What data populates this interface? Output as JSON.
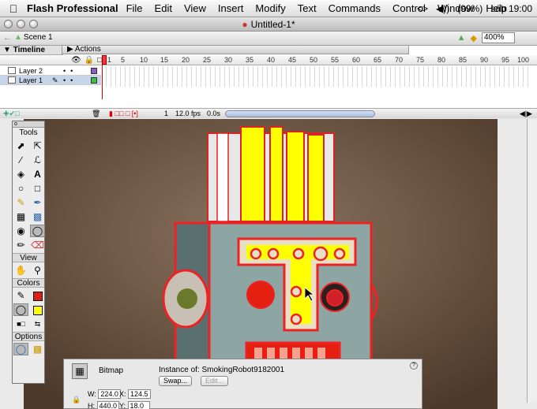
{
  "menubar": {
    "app_name": "Flash Professional",
    "menus": [
      "File",
      "Edit",
      "View",
      "Insert",
      "Modify",
      "Text",
      "Commands",
      "Control",
      "Window",
      "Help"
    ],
    "status": {
      "arrows": "<>",
      "volume": "◀))",
      "battery": "(99%)",
      "clock": "sáb 19:00"
    }
  },
  "window": {
    "title": "Untitled-1*"
  },
  "editbar": {
    "scene_label": "Scene 1",
    "zoom": "400%"
  },
  "actions_panel": {
    "label": "▶ Actions"
  },
  "timeline": {
    "label": "▼ Timeline",
    "ruler_ticks": [
      "1",
      "5",
      "10",
      "15",
      "20",
      "25",
      "30",
      "35",
      "40",
      "45",
      "50",
      "55",
      "60",
      "65",
      "70",
      "75",
      "80",
      "85",
      "90",
      "95",
      "100"
    ],
    "layers": [
      {
        "name": "Layer 2",
        "color": "#8b5cc7",
        "selected": false
      },
      {
        "name": "Layer 1",
        "color": "#3cbf3c",
        "selected": true
      }
    ],
    "current_frame": "1",
    "fps": "12.0 fps",
    "elapsed": "0.0s"
  },
  "tools": {
    "title": "Tools",
    "view_label": "View",
    "colors_label": "Colors",
    "options_label": "Options",
    "stroke_color": "#e02010",
    "fill_color": "#ffff00"
  },
  "properties": {
    "type_label": "Bitmap",
    "instance_label": "Instance of:",
    "instance_name": "SmokingRobot9182001",
    "swap_label": "Swap...",
    "edit_label": "Edit...",
    "w_label": "W:",
    "w_value": "224.0",
    "h_label": "H:",
    "h_value": "440.0",
    "x_label": "X:",
    "x_value": "124.5",
    "y_label": "Y:",
    "y_value": "18.0"
  }
}
